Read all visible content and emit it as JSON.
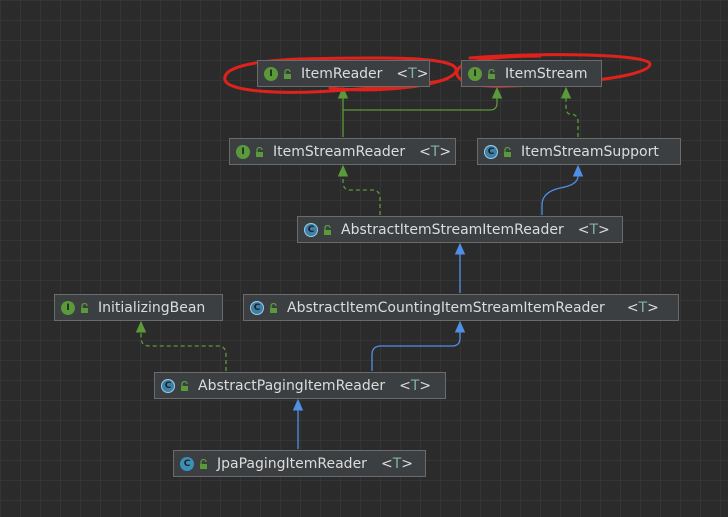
{
  "colors": {
    "background": "#2b2b2b",
    "extends_arrow": "#4f8fe6",
    "implements_arrow": "#5a9a3a",
    "annotation": "#e0221c"
  },
  "nodes": [
    {
      "id": "item_reader",
      "kind": "interface",
      "kind_icon": "interface-icon",
      "kind_letter": "I",
      "name": "ItemReader",
      "generic_open": "<",
      "type_param": "T",
      "generic_close": ">"
    },
    {
      "id": "item_stream",
      "kind": "interface",
      "kind_icon": "interface-icon",
      "kind_letter": "I",
      "name": "ItemStream"
    },
    {
      "id": "item_stream_reader",
      "kind": "interface",
      "kind_icon": "interface-icon",
      "kind_letter": "I",
      "name": "ItemStreamReader",
      "generic_open": "<",
      "type_param": "T",
      "generic_close": ">"
    },
    {
      "id": "item_stream_support",
      "kind": "abstract",
      "kind_icon": "abstract-class-icon",
      "kind_letter": "C",
      "name": "ItemStreamSupport"
    },
    {
      "id": "abstract_item_stream_item_reader",
      "kind": "abstract",
      "kind_icon": "abstract-class-icon",
      "kind_letter": "C",
      "name": "AbstractItemStreamItemReader",
      "generic_open": "<",
      "type_param": "T",
      "generic_close": ">"
    },
    {
      "id": "initializing_bean",
      "kind": "interface",
      "kind_icon": "interface-icon",
      "kind_letter": "I",
      "name": "InitializingBean"
    },
    {
      "id": "abstract_item_counting",
      "kind": "abstract",
      "kind_icon": "abstract-class-icon",
      "kind_letter": "C",
      "name": "AbstractItemCountingItemStreamItemReader",
      "generic_open": "<",
      "type_param": "T",
      "generic_close": ">"
    },
    {
      "id": "abstract_paging",
      "kind": "abstract",
      "kind_icon": "abstract-class-icon",
      "kind_letter": "C",
      "name": "AbstractPagingItemReader",
      "generic_open": "<",
      "type_param": "T",
      "generic_close": ">"
    },
    {
      "id": "jpa_paging",
      "kind": "class",
      "kind_icon": "class-icon",
      "kind_letter": "C",
      "name": "JpaPagingItemReader",
      "generic_open": "<",
      "type_param": "T",
      "generic_close": ">"
    }
  ],
  "edges": [
    {
      "from": "item_stream_reader",
      "to": "item_reader",
      "relation": "extends interface"
    },
    {
      "from": "item_stream_reader",
      "to": "item_stream",
      "relation": "extends interface"
    },
    {
      "from": "item_stream_support",
      "to": "item_stream",
      "relation": "implements"
    },
    {
      "from": "abstract_item_stream_item_reader",
      "to": "item_stream_reader",
      "relation": "implements"
    },
    {
      "from": "abstract_item_stream_item_reader",
      "to": "item_stream_support",
      "relation": "extends"
    },
    {
      "from": "abstract_item_counting",
      "to": "abstract_item_stream_item_reader",
      "relation": "extends"
    },
    {
      "from": "abstract_paging",
      "to": "abstract_item_counting",
      "relation": "extends"
    },
    {
      "from": "abstract_paging",
      "to": "initializing_bean",
      "relation": "implements"
    },
    {
      "from": "jpa_paging",
      "to": "abstract_paging",
      "relation": "extends"
    }
  ],
  "annotations": [
    {
      "shape": "hand-drawn circle",
      "around": "item_reader"
    },
    {
      "shape": "hand-drawn circle",
      "around": "item_stream"
    }
  ]
}
